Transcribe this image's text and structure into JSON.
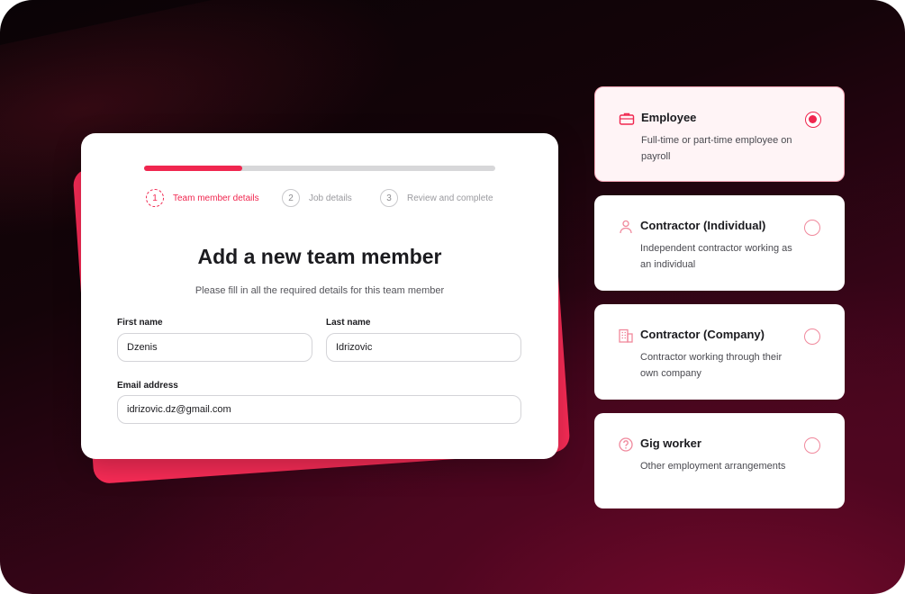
{
  "form": {
    "progress_fraction": 0.28,
    "steps": [
      {
        "number": "1",
        "label": "Team member details",
        "active": true
      },
      {
        "number": "2",
        "label": "Job details",
        "active": false
      },
      {
        "number": "3",
        "label": "Review and complete",
        "active": false
      }
    ],
    "title": "Add a new team member",
    "subtitle": "Please fill in all the required details for this team member",
    "first_name": {
      "label": "First name",
      "value": "Dzenis"
    },
    "last_name": {
      "label": "Last name",
      "value": "Idrizovic"
    },
    "email": {
      "label": "Email address",
      "value": "idrizovic.dz@gmail.com"
    }
  },
  "options": [
    {
      "title": "Employee",
      "description": "Full-time or part-time employee on payroll",
      "icon": "briefcase-icon",
      "selected": true
    },
    {
      "title": "Contractor (Individual)",
      "description": "Independent contractor working as an individual",
      "icon": "person-icon",
      "selected": false
    },
    {
      "title": "Contractor (Company)",
      "description": "Contractor working through their own company",
      "icon": "building-icon",
      "selected": false
    },
    {
      "title": "Gig worker",
      "description": "Other employment arrangements",
      "icon": "question-circle-icon",
      "selected": false
    }
  ],
  "colors": {
    "accent": "#f0264f",
    "accent_shadow": "#fb2c57",
    "selected_bg": "#fff4f6",
    "icon_pink": "#f0889c"
  }
}
